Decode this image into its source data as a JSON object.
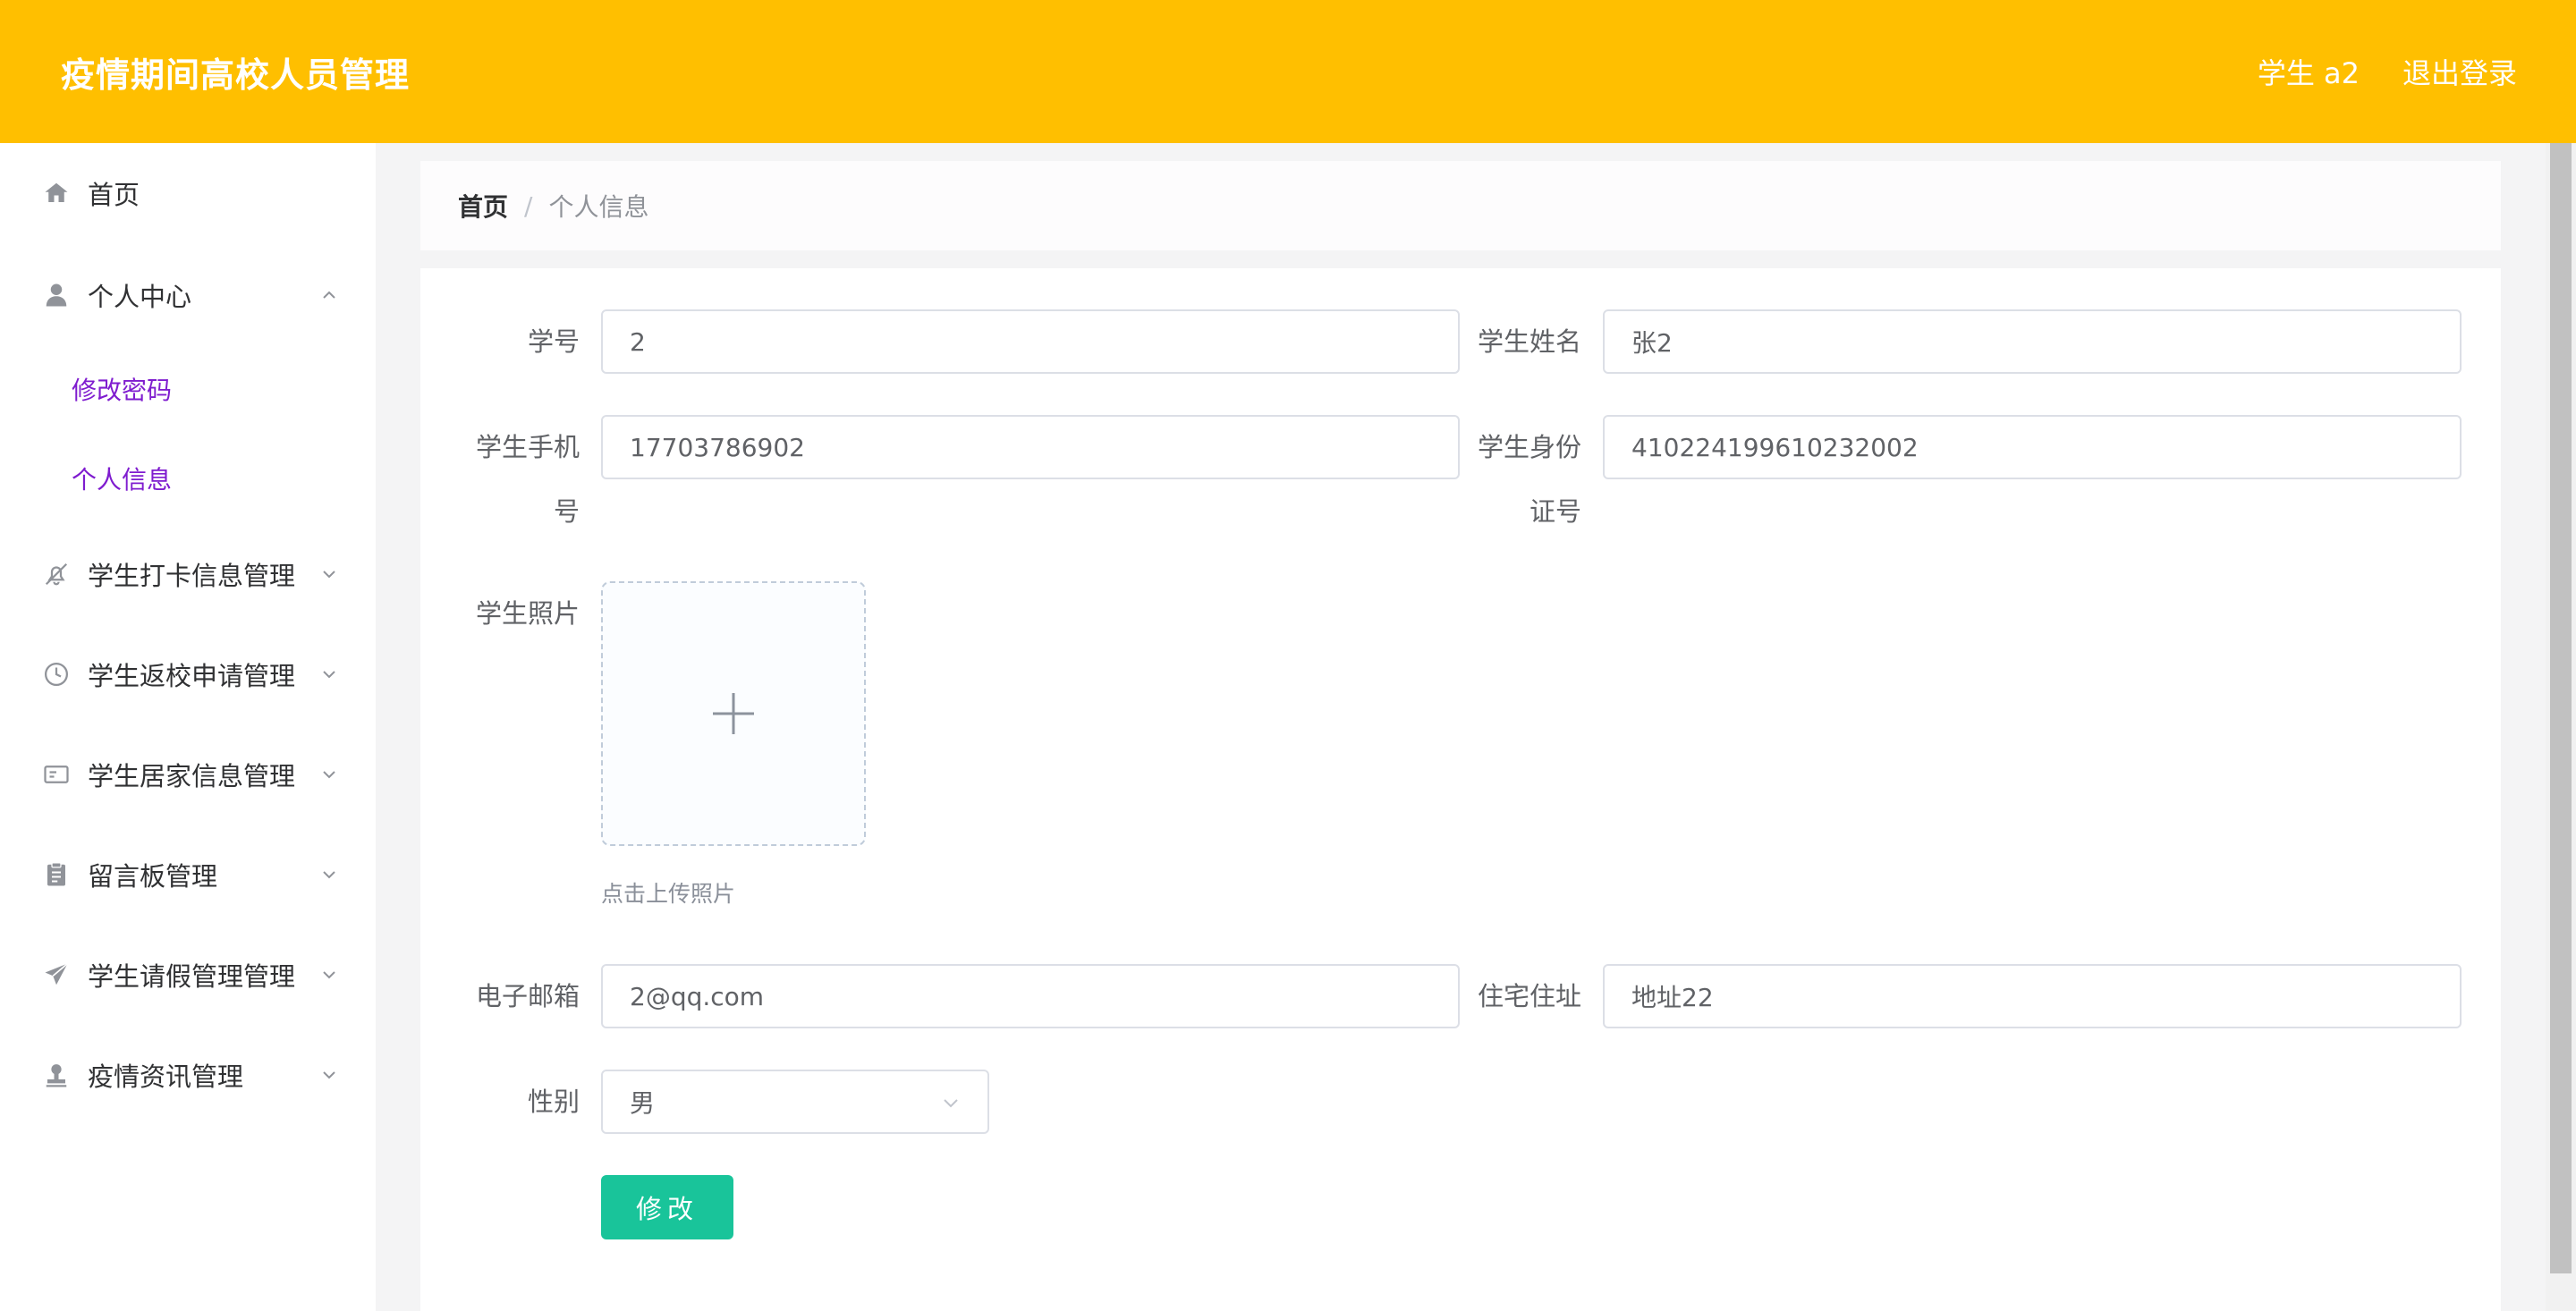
{
  "header": {
    "title": "疫情期间高校人员管理",
    "user": "学生 a2",
    "logout": "退出登录"
  },
  "sidebar": {
    "items": [
      {
        "label": "首页",
        "icon": "home-icon"
      },
      {
        "label": "个人中心",
        "icon": "user-icon",
        "expanded": true,
        "children": [
          {
            "label": "修改密码"
          },
          {
            "label": "个人信息"
          }
        ]
      },
      {
        "label": "学生打卡信息管理",
        "icon": "bell-off-icon"
      },
      {
        "label": "学生返校申请管理",
        "icon": "clock-icon"
      },
      {
        "label": "学生居家信息管理",
        "icon": "id-card-icon"
      },
      {
        "label": "留言板管理",
        "icon": "clipboard-icon"
      },
      {
        "label": "学生请假管理管理",
        "icon": "paper-plane-icon"
      },
      {
        "label": "疫情资讯管理",
        "icon": "stamp-icon"
      }
    ]
  },
  "breadcrumb": {
    "home": "首页",
    "separator": "/",
    "current": "个人信息"
  },
  "form": {
    "student_no": {
      "label": "学号",
      "value": "2"
    },
    "student_name": {
      "label": "学生姓名",
      "value": "张2"
    },
    "phone": {
      "label_line1": "学生手机",
      "label_line2": "号",
      "value": "17703786902"
    },
    "id_card": {
      "label_line1": "学生身份",
      "label_line2": "证号",
      "value": "410224199610232002"
    },
    "photo": {
      "label": "学生照片",
      "hint": "点击上传照片"
    },
    "email": {
      "label": "电子邮箱",
      "value": "2@qq.com"
    },
    "address": {
      "label": "住宅住址",
      "value": "地址22"
    },
    "gender": {
      "label": "性别",
      "value": "男"
    },
    "submit_label": "修改"
  },
  "colors": {
    "header_bg": "#ffbf00",
    "submenu_active": "#7f1ccf",
    "submit_bg": "#19c49a"
  }
}
